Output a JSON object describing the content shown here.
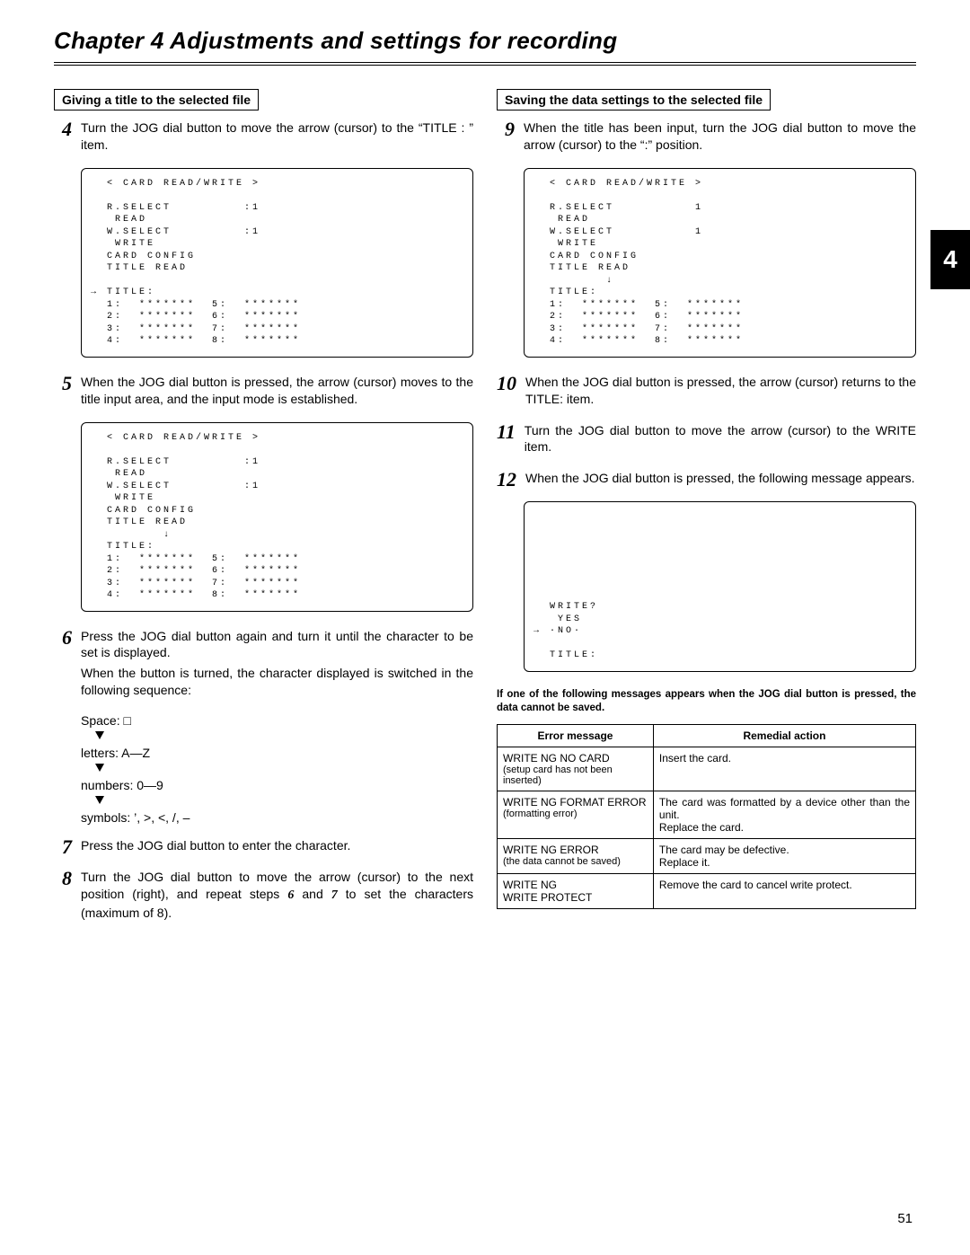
{
  "page": {
    "title": "Chapter 4  Adjustments and settings for recording",
    "tab": "4",
    "number": "51"
  },
  "left": {
    "box": "Giving a title to the selected file",
    "steps": {
      "4": "Turn the JOG dial button to move the arrow (cursor) to the “TITLE : ” item.",
      "5": "When the JOG dial button is pressed, the arrow (cursor) moves to the title input area, and the input mode is established.",
      "6_a": "Press the JOG dial button again and turn it until the character to be set is displayed.",
      "6_b": "When the button is turned, the character displayed is switched in the following sequence:",
      "7": "Press the JOG dial button to enter the character.",
      "8_a": "Turn the JOG dial button to move the arrow (cursor) to the next position (right), and repeat steps ",
      "8_b": " and ",
      "8_c": " to set the characters (maximum of 8).",
      "8_s6": "6",
      "8_s7": "7"
    },
    "seq": {
      "space": "Space: □",
      "letters": "letters: A—Z",
      "numbers": "numbers: 0—9",
      "symbols": "symbols: ’, >, <, /, –"
    },
    "screens": {
      "s4": "  < CARD READ/WRITE >\n\n  R.SELECT         :1\n   READ\n  W.SELECT         :1\n   WRITE\n  CARD CONFIG\n  TITLE READ\n\n→ TITLE:\n  1:  *******  5:  *******\n  2:  *******  6:  *******\n  3:  *******  7:  *******\n  4:  *******  8:  *******",
      "s5": "  < CARD READ/WRITE >\n\n  R.SELECT         :1\n   READ\n  W.SELECT         :1\n   WRITE\n  CARD CONFIG\n  TITLE READ\n         ↓\n  TITLE:\n  1:  *******  5:  *******\n  2:  *******  6:  *******\n  3:  *******  7:  *******\n  4:  *******  8:  *******"
    }
  },
  "right": {
    "box": "Saving the data settings to the selected file",
    "steps": {
      "9": "When the title has been input, turn the JOG dial button to move the arrow (cursor) to the “:” position.",
      "10": "When the JOG dial button is pressed, the arrow (cursor) returns to the TITLE: item.",
      "11": "Turn the JOG dial button to move the arrow (cursor) to the WRITE item.",
      "12": "When the JOG dial button is pressed, the following message appears."
    },
    "screens": {
      "s9": "  < CARD READ/WRITE >\n\n  R.SELECT          1\n   READ\n  W.SELECT          1\n   WRITE\n  CARD CONFIG\n  TITLE READ\n         ↓\n  TITLE:\n  1:  *******  5:  *******\n  2:  *******  6:  *******\n  3:  *******  7:  *******\n  4:  *******  8:  *******",
      "s12": "  WRITE?\n   YES\n→ ·NO·\n\n  TITLE:"
    },
    "warn": "If one of the following messages appears when the JOG dial button is pressed, the data cannot be saved.",
    "table": {
      "h1": "Error message",
      "h2": "Remedial action",
      "rows": [
        {
          "msg": "WRITE NG NO CARD",
          "sub": "(setup card has not been inserted)",
          "action": "Insert the card."
        },
        {
          "msg": "WRITE NG FORMAT ERROR",
          "sub": "(formatting error)",
          "action": "The card was formatted by a device other than the unit.\nReplace the card."
        },
        {
          "msg": "WRITE NG ERROR",
          "sub": "(the data cannot be saved)",
          "action": "The card may be defective.\nReplace it."
        },
        {
          "msg": "WRITE NG\nWRITE PROTECT",
          "sub": "",
          "action": "Remove the card to cancel write protect."
        }
      ]
    }
  }
}
